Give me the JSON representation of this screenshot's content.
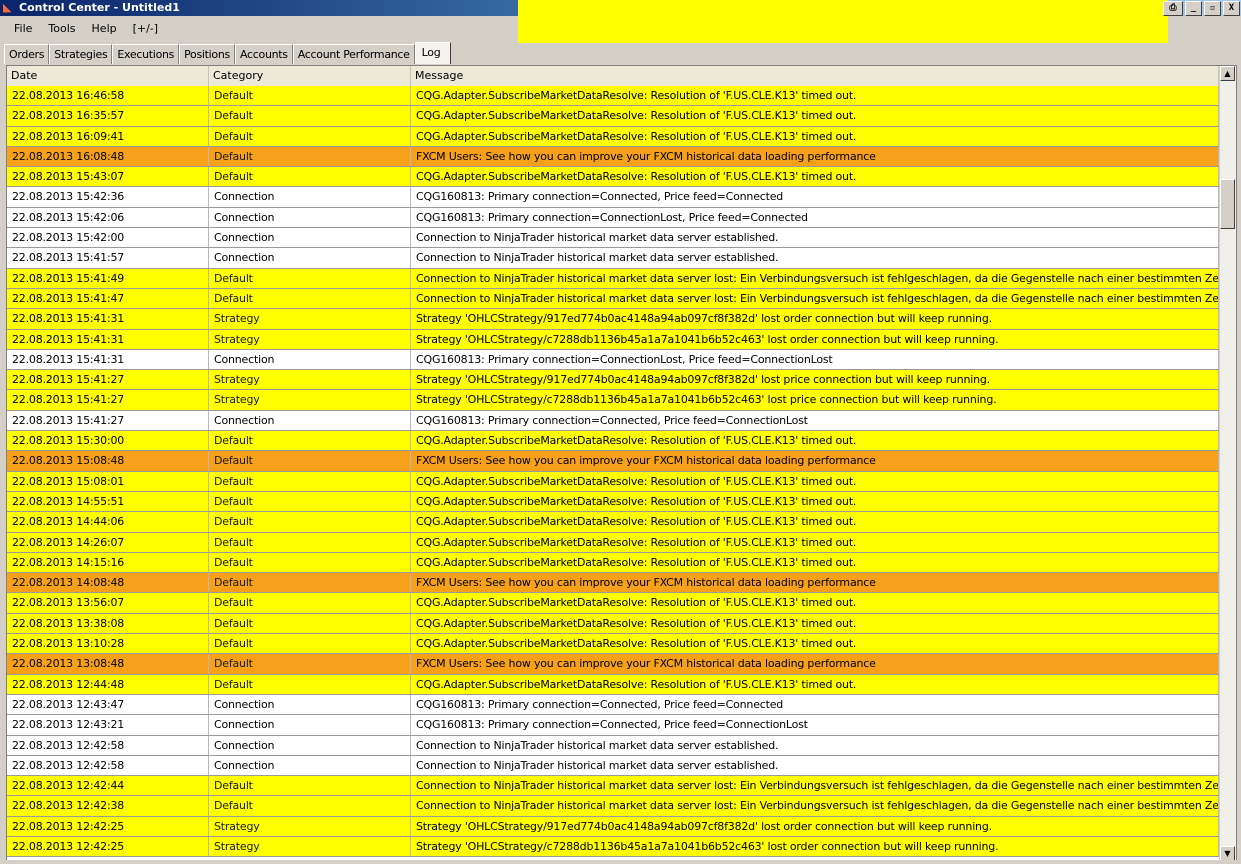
{
  "window": {
    "title": "Control Center - Untitled1",
    "controls": [
      "⎙",
      "_",
      "▫",
      "X"
    ]
  },
  "menu": [
    "File",
    "Tools",
    "Help",
    "[+/-]"
  ],
  "tabs": [
    {
      "label": "Orders",
      "active": false
    },
    {
      "label": "Strategies",
      "active": false
    },
    {
      "label": "Executions",
      "active": false
    },
    {
      "label": "Positions",
      "active": false
    },
    {
      "label": "Accounts",
      "active": false
    },
    {
      "label": "Account Performance",
      "active": false
    },
    {
      "label": "Log",
      "active": true
    }
  ],
  "grid": {
    "columns": [
      "Date",
      "Category",
      "Message"
    ],
    "colors": {
      "default": "#ffff00",
      "alert": "#f7a11b",
      "connection": "#ffffff"
    },
    "rows": [
      {
        "date": "22.08.2013 16:46:58",
        "category": "Default",
        "message": "CQG.Adapter.SubscribeMarketDataResolve: Resolution of 'F.US.CLE.K13' timed out.",
        "severity": "default"
      },
      {
        "date": "22.08.2013 16:35:57",
        "category": "Default",
        "message": "CQG.Adapter.SubscribeMarketDataResolve: Resolution of 'F.US.CLE.K13' timed out.",
        "severity": "default"
      },
      {
        "date": "22.08.2013 16:09:41",
        "category": "Default",
        "message": "CQG.Adapter.SubscribeMarketDataResolve: Resolution of 'F.US.CLE.K13' timed out.",
        "severity": "default"
      },
      {
        "date": "22.08.2013 16:08:48",
        "category": "Default",
        "message": "FXCM Users: See how you can improve your FXCM historical data loading performance",
        "severity": "alert"
      },
      {
        "date": "22.08.2013 15:43:07",
        "category": "Default",
        "message": "CQG.Adapter.SubscribeMarketDataResolve: Resolution of 'F.US.CLE.K13' timed out.",
        "severity": "default"
      },
      {
        "date": "22.08.2013 15:42:36",
        "category": "Connection",
        "message": "CQG160813: Primary connection=Connected, Price feed=Connected",
        "severity": "connection"
      },
      {
        "date": "22.08.2013 15:42:06",
        "category": "Connection",
        "message": "CQG160813: Primary connection=ConnectionLost, Price feed=Connected",
        "severity": "connection"
      },
      {
        "date": "22.08.2013 15:42:00",
        "category": "Connection",
        "message": "Connection to NinjaTrader historical market data server established.",
        "severity": "connection"
      },
      {
        "date": "22.08.2013 15:41:57",
        "category": "Connection",
        "message": "Connection to NinjaTrader historical market data server established.",
        "severity": "connection"
      },
      {
        "date": "22.08.2013 15:41:49",
        "category": "Default",
        "message": "Connection to NinjaTrader historical market data server lost: Ein Verbindungsversuch ist fehlgeschlagen, da die Gegenstelle nach einer bestimmten Zeitspanne nich",
        "severity": "default"
      },
      {
        "date": "22.08.2013 15:41:47",
        "category": "Default",
        "message": "Connection to NinjaTrader historical market data server lost: Ein Verbindungsversuch ist fehlgeschlagen, da die Gegenstelle nach einer bestimmten Zeitspanne nich",
        "severity": "default"
      },
      {
        "date": "22.08.2013 15:41:31",
        "category": "Strategy",
        "message": "Strategy 'OHLCStrategy/917ed774b0ac4148a94ab097cf8f382d' lost order connection but will keep running.",
        "severity": "strategy"
      },
      {
        "date": "22.08.2013 15:41:31",
        "category": "Strategy",
        "message": "Strategy 'OHLCStrategy/c7288db1136b45a1a7a1041b6b52c463' lost order connection but will keep running.",
        "severity": "strategy"
      },
      {
        "date": "22.08.2013 15:41:31",
        "category": "Connection",
        "message": "CQG160813: Primary connection=ConnectionLost, Price feed=ConnectionLost",
        "severity": "connection"
      },
      {
        "date": "22.08.2013 15:41:27",
        "category": "Strategy",
        "message": "Strategy 'OHLCStrategy/917ed774b0ac4148a94ab097cf8f382d' lost price connection but will keep running.",
        "severity": "strategy"
      },
      {
        "date": "22.08.2013 15:41:27",
        "category": "Strategy",
        "message": "Strategy 'OHLCStrategy/c7288db1136b45a1a7a1041b6b52c463' lost price connection but will keep running.",
        "severity": "strategy"
      },
      {
        "date": "22.08.2013 15:41:27",
        "category": "Connection",
        "message": "CQG160813: Primary connection=Connected, Price feed=ConnectionLost",
        "severity": "connection"
      },
      {
        "date": "22.08.2013 15:30:00",
        "category": "Default",
        "message": "CQG.Adapter.SubscribeMarketDataResolve: Resolution of 'F.US.CLE.K13' timed out.",
        "severity": "default"
      },
      {
        "date": "22.08.2013 15:08:48",
        "category": "Default",
        "message": "FXCM Users: See how you can improve your FXCM historical data loading performance",
        "severity": "alert"
      },
      {
        "date": "22.08.2013 15:08:01",
        "category": "Default",
        "message": "CQG.Adapter.SubscribeMarketDataResolve: Resolution of 'F.US.CLE.K13' timed out.",
        "severity": "default"
      },
      {
        "date": "22.08.2013 14:55:51",
        "category": "Default",
        "message": "CQG.Adapter.SubscribeMarketDataResolve: Resolution of 'F.US.CLE.K13' timed out.",
        "severity": "default"
      },
      {
        "date": "22.08.2013 14:44:06",
        "category": "Default",
        "message": "CQG.Adapter.SubscribeMarketDataResolve: Resolution of 'F.US.CLE.K13' timed out.",
        "severity": "default"
      },
      {
        "date": "22.08.2013 14:26:07",
        "category": "Default",
        "message": "CQG.Adapter.SubscribeMarketDataResolve: Resolution of 'F.US.CLE.K13' timed out.",
        "severity": "default"
      },
      {
        "date": "22.08.2013 14:15:16",
        "category": "Default",
        "message": "CQG.Adapter.SubscribeMarketDataResolve: Resolution of 'F.US.CLE.K13' timed out.",
        "severity": "default"
      },
      {
        "date": "22.08.2013 14:08:48",
        "category": "Default",
        "message": "FXCM Users: See how you can improve your FXCM historical data loading performance",
        "severity": "alert"
      },
      {
        "date": "22.08.2013 13:56:07",
        "category": "Default",
        "message": "CQG.Adapter.SubscribeMarketDataResolve: Resolution of 'F.US.CLE.K13' timed out.",
        "severity": "default"
      },
      {
        "date": "22.08.2013 13:38:08",
        "category": "Default",
        "message": "CQG.Adapter.SubscribeMarketDataResolve: Resolution of 'F.US.CLE.K13' timed out.",
        "severity": "default"
      },
      {
        "date": "22.08.2013 13:10:28",
        "category": "Default",
        "message": "CQG.Adapter.SubscribeMarketDataResolve: Resolution of 'F.US.CLE.K13' timed out.",
        "severity": "default"
      },
      {
        "date": "22.08.2013 13:08:48",
        "category": "Default",
        "message": "FXCM Users: See how you can improve your FXCM historical data loading performance",
        "severity": "alert"
      },
      {
        "date": "22.08.2013 12:44:48",
        "category": "Default",
        "message": "CQG.Adapter.SubscribeMarketDataResolve: Resolution of 'F.US.CLE.K13' timed out.",
        "severity": "default"
      },
      {
        "date": "22.08.2013 12:43:47",
        "category": "Connection",
        "message": "CQG160813: Primary connection=Connected, Price feed=Connected",
        "severity": "connection"
      },
      {
        "date": "22.08.2013 12:43:21",
        "category": "Connection",
        "message": "CQG160813: Primary connection=Connected, Price feed=ConnectionLost",
        "severity": "connection"
      },
      {
        "date": "22.08.2013 12:42:58",
        "category": "Connection",
        "message": "Connection to NinjaTrader historical market data server established.",
        "severity": "connection"
      },
      {
        "date": "22.08.2013 12:42:58",
        "category": "Connection",
        "message": "Connection to NinjaTrader historical market data server established.",
        "severity": "connection"
      },
      {
        "date": "22.08.2013 12:42:44",
        "category": "Default",
        "message": "Connection to NinjaTrader historical market data server lost: Ein Verbindungsversuch ist fehlgeschlagen, da die Gegenstelle nach einer bestimmten Zeitspanne nich",
        "severity": "default"
      },
      {
        "date": "22.08.2013 12:42:38",
        "category": "Default",
        "message": "Connection to NinjaTrader historical market data server lost: Ein Verbindungsversuch ist fehlgeschlagen, da die Gegenstelle nach einer bestimmten Zeitspanne nich",
        "severity": "default"
      },
      {
        "date": "22.08.2013 12:42:25",
        "category": "Strategy",
        "message": "Strategy 'OHLCStrategy/917ed774b0ac4148a94ab097cf8f382d' lost order connection but will keep running.",
        "severity": "strategy"
      },
      {
        "date": "22.08.2013 12:42:25",
        "category": "Strategy",
        "message": "Strategy 'OHLCStrategy/c7288db1136b45a1a7a1041b6b52c463' lost order connection but will keep running.",
        "severity": "strategy"
      }
    ]
  }
}
